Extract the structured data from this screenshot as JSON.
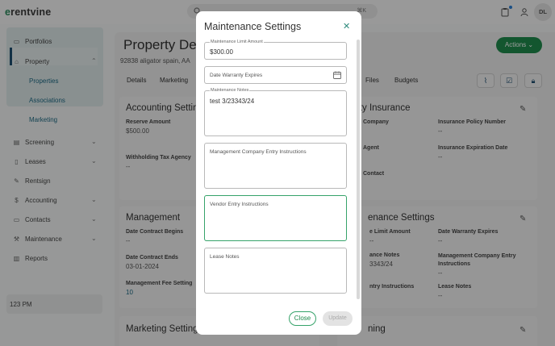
{
  "app": {
    "logo_prefix": "e",
    "logo_rest": "rentvine",
    "search_shortcut": "⌘K",
    "user_initials": "DL"
  },
  "sidebar": {
    "items": [
      {
        "id": "portfolios",
        "label": "Portfolios",
        "icon": "folder-icon"
      },
      {
        "id": "property",
        "label": "Property",
        "icon": "building-icon"
      },
      {
        "id": "screening",
        "label": "Screening",
        "icon": "clipboard-icon"
      },
      {
        "id": "leases",
        "label": "Leases",
        "icon": "file-icon"
      },
      {
        "id": "rentsign",
        "label": "Rentsign",
        "icon": "pen-icon"
      },
      {
        "id": "accounting",
        "label": "Accounting",
        "icon": "dollar-icon"
      },
      {
        "id": "contacts",
        "label": "Contacts",
        "icon": "contact-card-icon"
      },
      {
        "id": "maintenance",
        "label": "Maintenance",
        "icon": "wrench-icon"
      },
      {
        "id": "reports",
        "label": "Reports",
        "icon": "chart-icon"
      }
    ],
    "property_sub": [
      "Properties",
      "Associations",
      "Marketing"
    ],
    "time": "123 PM"
  },
  "page": {
    "title": "Property Det",
    "subtitle": "92838 aligator spain, AA",
    "actions_label": "Actions",
    "tabs": [
      "Details",
      "Marketing",
      "Files",
      "Budgets"
    ]
  },
  "cards": {
    "accounting": {
      "title": "Accounting Setting",
      "reserve_label": "Reserve Amount",
      "reserve_value": "$500.00",
      "withholding_label": "Withholding Tax Agency",
      "withholding_value": "--"
    },
    "insurance": {
      "title": "rty Insurance",
      "company_label": "Company",
      "agent_label": "Agent",
      "contact_label": "Contact",
      "policy_label": "Insurance Policy Number",
      "policy_value": "--",
      "expiration_label": "Insurance Expiration Date",
      "expiration_value": "--"
    },
    "management": {
      "title": "Management",
      "begins_label": "Date Contract Begins",
      "begins_value": "--",
      "ends_label": "Date Contract Ends",
      "ends_value": "03-01-2024",
      "fee_label": "Management Fee Setting",
      "fee_value": "10"
    },
    "maintenance_bg": {
      "title": "enance Settings",
      "limit_label": "e Limit Amount",
      "limit_value": "--",
      "warranty_label": "Date Warranty Expires",
      "warranty_value": "--",
      "notes_label": "ance Notes",
      "notes_value": "3343/24",
      "mgmt_label": "Management Company Entry Instructions",
      "mgmt_value": "--",
      "entry_label": "ntry Instructions",
      "lease_label": "Lease Notes",
      "lease_value": "--"
    },
    "marketing": {
      "title": "Marketing Setting",
      "right_title": "ning"
    }
  },
  "modal": {
    "title": "Maintenance Settings",
    "fields": {
      "limit": {
        "label": "Maintenance Limit Amount",
        "value": "$300.00"
      },
      "warranty": {
        "placeholder": "Date Warranty Expires"
      },
      "notes": {
        "label": "Maintenance Notes",
        "value": "test 3/23343/24"
      },
      "mgmt": {
        "placeholder": "Management Company Entry Instructions"
      },
      "vendor": {
        "placeholder": "Vendor Entry Instructions"
      },
      "lease": {
        "placeholder": "Lease Notes"
      }
    },
    "close_label": "Close",
    "update_label": "Update"
  }
}
